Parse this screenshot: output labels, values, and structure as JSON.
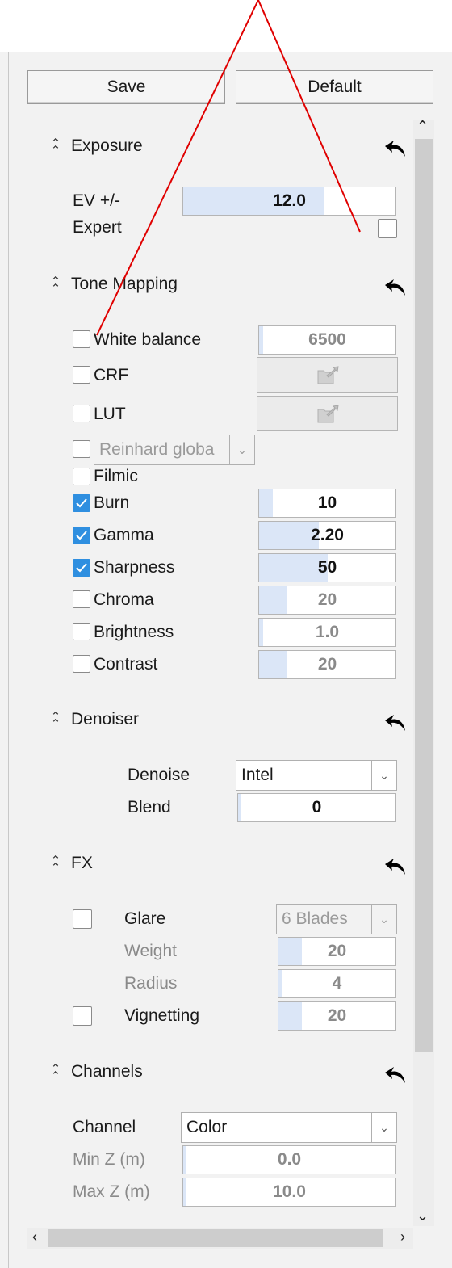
{
  "header": {
    "save_label": "Save",
    "default_label": "Default"
  },
  "sections": {
    "exposure": {
      "title": "Exposure",
      "ev_label": "EV +/-",
      "ev_value": "12.0",
      "ev_fraction": 0.66,
      "expert_label": "Expert",
      "expert_checked": false
    },
    "tone_mapping": {
      "title": "Tone Mapping",
      "white_balance_label": "White balance",
      "white_balance_value": "6500",
      "crf_label": "CRF",
      "lut_label": "LUT",
      "operator_value": "Reinhard globa",
      "filmic_label": "Filmic",
      "burn_label": "Burn",
      "burn_value": "10",
      "gamma_label": "Gamma",
      "gamma_value": "2.20",
      "sharpness_label": "Sharpness",
      "sharpness_value": "50",
      "chroma_label": "Chroma",
      "chroma_value": "20",
      "brightness_label": "Brightness",
      "brightness_value": "1.0",
      "contrast_label": "Contrast",
      "contrast_value": "20"
    },
    "denoiser": {
      "title": "Denoiser",
      "denoise_label": "Denoise",
      "denoise_value": "Intel",
      "blend_label": "Blend",
      "blend_value": "0"
    },
    "fx": {
      "title": "FX",
      "glare_label": "Glare",
      "glare_value": "6 Blades",
      "weight_label": "Weight",
      "weight_value": "20",
      "radius_label": "Radius",
      "radius_value": "4",
      "vignetting_label": "Vignetting",
      "vignetting_value": "20"
    },
    "channels": {
      "title": "Channels",
      "channel_label": "Channel",
      "channel_value": "Color",
      "minz_label": "Min Z (m)",
      "minz_value": "0.0",
      "maxz_label": "Max Z (m)",
      "maxz_value": "10.0"
    }
  },
  "checkbox_states": {
    "white_balance": false,
    "crf": false,
    "lut": false,
    "operator": false,
    "filmic": false,
    "burn": true,
    "gamma": true,
    "sharpness": true,
    "chroma": false,
    "brightness": false,
    "contrast": false,
    "glare": false,
    "vignetting": false
  },
  "colors": {
    "accent": "#2f8fe0",
    "slider_fill": "#dbe6f7",
    "annotation": "#e00000"
  },
  "icons": [
    "collapse-chevron-icon",
    "undo-icon",
    "file-open-icon",
    "dropdown-arrow-icon",
    "scroll-arrow-icon"
  ]
}
